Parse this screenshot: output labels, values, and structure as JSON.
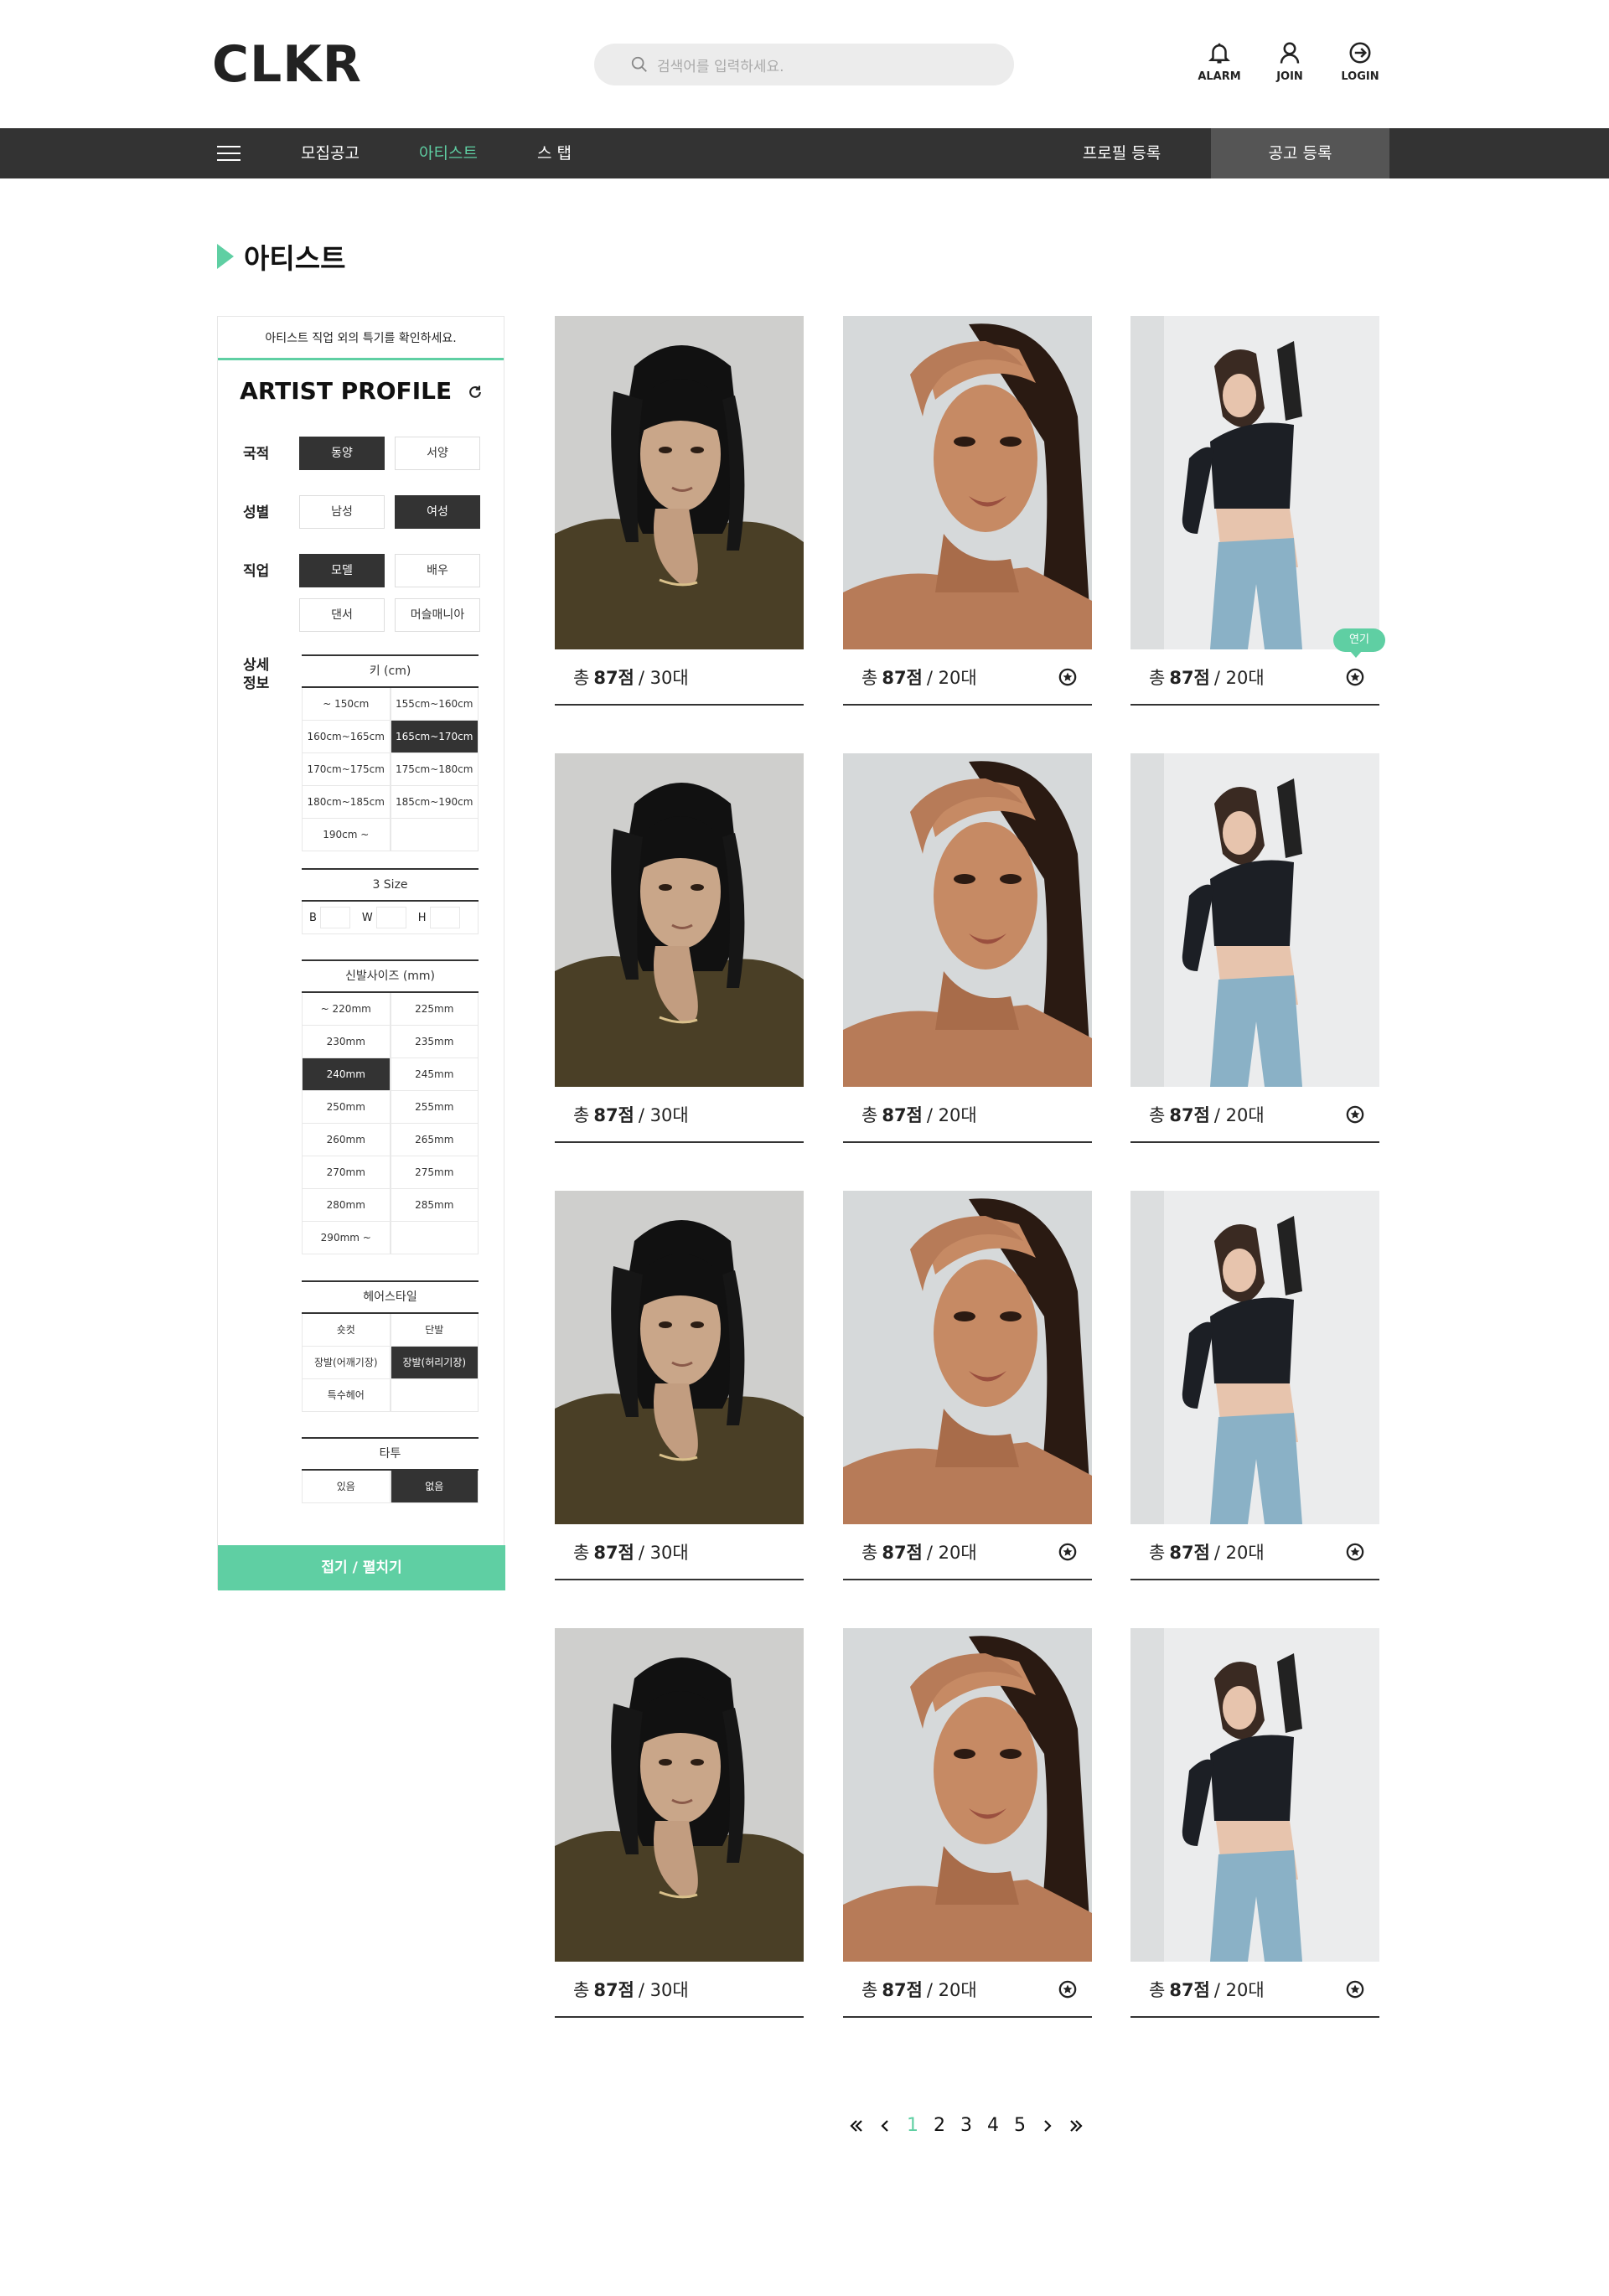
{
  "header": {
    "logo": "CLKR",
    "search_placeholder": "검색어를 입력하세요.",
    "icons": [
      {
        "name": "bell-icon",
        "label": "ALARM"
      },
      {
        "name": "user-icon",
        "label": "JOIN"
      },
      {
        "name": "login-icon",
        "label": "LOGIN"
      }
    ]
  },
  "nav": {
    "items": [
      {
        "label": "모집공고",
        "active": false
      },
      {
        "label": "아티스트",
        "active": true
      },
      {
        "label": "스 탭",
        "active": false
      }
    ],
    "profile_btn": "프로필 등록",
    "notice_btn": "공고 등록",
    "accent": "#5fcfa3"
  },
  "page": {
    "title": "아티스트"
  },
  "filter": {
    "note": "아티스트 직업 외의 특기를 확인하세요.",
    "title": "ARTIST PROFILE",
    "nationality": {
      "label": "국적",
      "options": [
        "동양",
        "서양"
      ],
      "selected": "동양"
    },
    "gender": {
      "label": "성별",
      "options": [
        "남성",
        "여성"
      ],
      "selected": "여성"
    },
    "job": {
      "label": "직업",
      "options": [
        "모델",
        "배우",
        "댄서",
        "머슬매니아"
      ],
      "selected": "모델"
    },
    "detail_label": "상세 정보",
    "height": {
      "title": "키 (cm)",
      "options": [
        "~ 150cm",
        "155cm~160cm",
        "160cm~165cm",
        "165cm~170cm",
        "170cm~175cm",
        "175cm~180cm",
        "180cm~185cm",
        "185cm~190cm",
        "190cm ~",
        ""
      ],
      "selected": "165cm~170cm"
    },
    "size3": {
      "title": "3 Size",
      "fields": [
        "B",
        "W",
        "H"
      ]
    },
    "shoe": {
      "title": "신발사이즈 (mm)",
      "options": [
        "~ 220mm",
        "225mm",
        "230mm",
        "235mm",
        "240mm",
        "245mm",
        "250mm",
        "255mm",
        "260mm",
        "265mm",
        "270mm",
        "275mm",
        "280mm",
        "285mm",
        "290mm ~",
        ""
      ],
      "selected": "240mm"
    },
    "hair": {
      "title": "헤어스타일",
      "options": [
        "숏컷",
        "단발",
        "장발(어깨기장)",
        "장발(허리기장)",
        "특수헤어",
        ""
      ],
      "selected": "장발(허리기장)"
    },
    "tattoo": {
      "title": "타투",
      "options": [
        "있음",
        "없음"
      ],
      "selected": "없음"
    },
    "toggle": "접기 / 펼치기"
  },
  "cards": [
    {
      "score_prefix": "총",
      "score": "87점",
      "age": "/ 30대",
      "photo": "man",
      "fav": false,
      "tag": ""
    },
    {
      "score_prefix": "총",
      "score": "87점",
      "age": "/ 20대",
      "photo": "woman1",
      "fav": true,
      "tag": ""
    },
    {
      "score_prefix": "총",
      "score": "87점",
      "age": "/ 20대",
      "photo": "woman2",
      "fav": true,
      "tag": "연기"
    },
    {
      "score_prefix": "총",
      "score": "87점",
      "age": "/ 30대",
      "photo": "man",
      "fav": false,
      "tag": ""
    },
    {
      "score_prefix": "총",
      "score": "87점",
      "age": "/ 20대",
      "photo": "woman1",
      "fav": false,
      "tag": ""
    },
    {
      "score_prefix": "총",
      "score": "87점",
      "age": "/ 20대",
      "photo": "woman2",
      "fav": true,
      "tag": ""
    },
    {
      "score_prefix": "총",
      "score": "87점",
      "age": "/ 30대",
      "photo": "man",
      "fav": false,
      "tag": ""
    },
    {
      "score_prefix": "총",
      "score": "87점",
      "age": "/ 20대",
      "photo": "woman1",
      "fav": true,
      "tag": ""
    },
    {
      "score_prefix": "총",
      "score": "87점",
      "age": "/ 20대",
      "photo": "woman2",
      "fav": true,
      "tag": ""
    },
    {
      "score_prefix": "총",
      "score": "87점",
      "age": "/ 30대",
      "photo": "man",
      "fav": false,
      "tag": ""
    },
    {
      "score_prefix": "총",
      "score": "87점",
      "age": "/ 20대",
      "photo": "woman1",
      "fav": true,
      "tag": ""
    },
    {
      "score_prefix": "총",
      "score": "87점",
      "age": "/ 20대",
      "photo": "woman2",
      "fav": true,
      "tag": ""
    }
  ],
  "pagination": {
    "pages": [
      "1",
      "2",
      "3",
      "4",
      "5"
    ],
    "current": "1"
  }
}
